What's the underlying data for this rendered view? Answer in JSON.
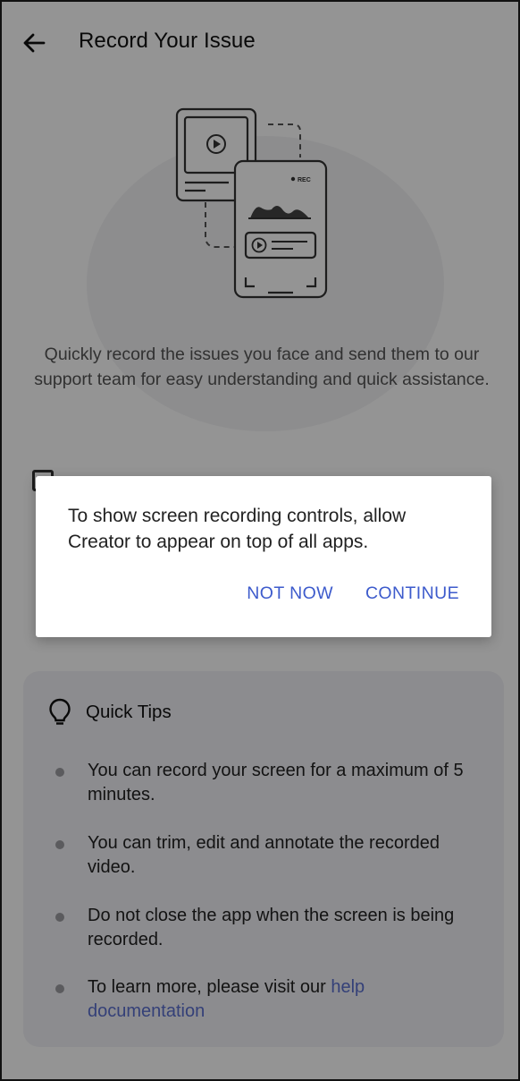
{
  "app_bar": {
    "title": "Record Your Issue"
  },
  "illustration": {
    "rec_label": "REC"
  },
  "intro": {
    "text": "Quickly record the issues you face and send them to our support team for easy understanding and quick assistance."
  },
  "tips": {
    "title": "Quick Tips",
    "items": [
      {
        "text": "You can record your screen for a maximum of 5 minutes."
      },
      {
        "text": "You can trim, edit and annotate the recorded video."
      },
      {
        "text": "Do not close the app when the screen is being recorded."
      },
      {
        "text": "To learn more, please visit our ",
        "link": "help documentation"
      }
    ]
  },
  "dialog": {
    "message": "To show screen recording controls, allow Creator to appear on top of all apps.",
    "not_now": "NOT NOW",
    "continue": "CONTINUE"
  },
  "colors": {
    "accent": "#3d5bcc",
    "link": "#5b6fcf",
    "card_bg": "#f2f2f7",
    "scrim": "rgba(0,0,0,0.42)"
  },
  "icons": {
    "back": "arrow-left-icon",
    "tips": "lightbulb-icon"
  }
}
